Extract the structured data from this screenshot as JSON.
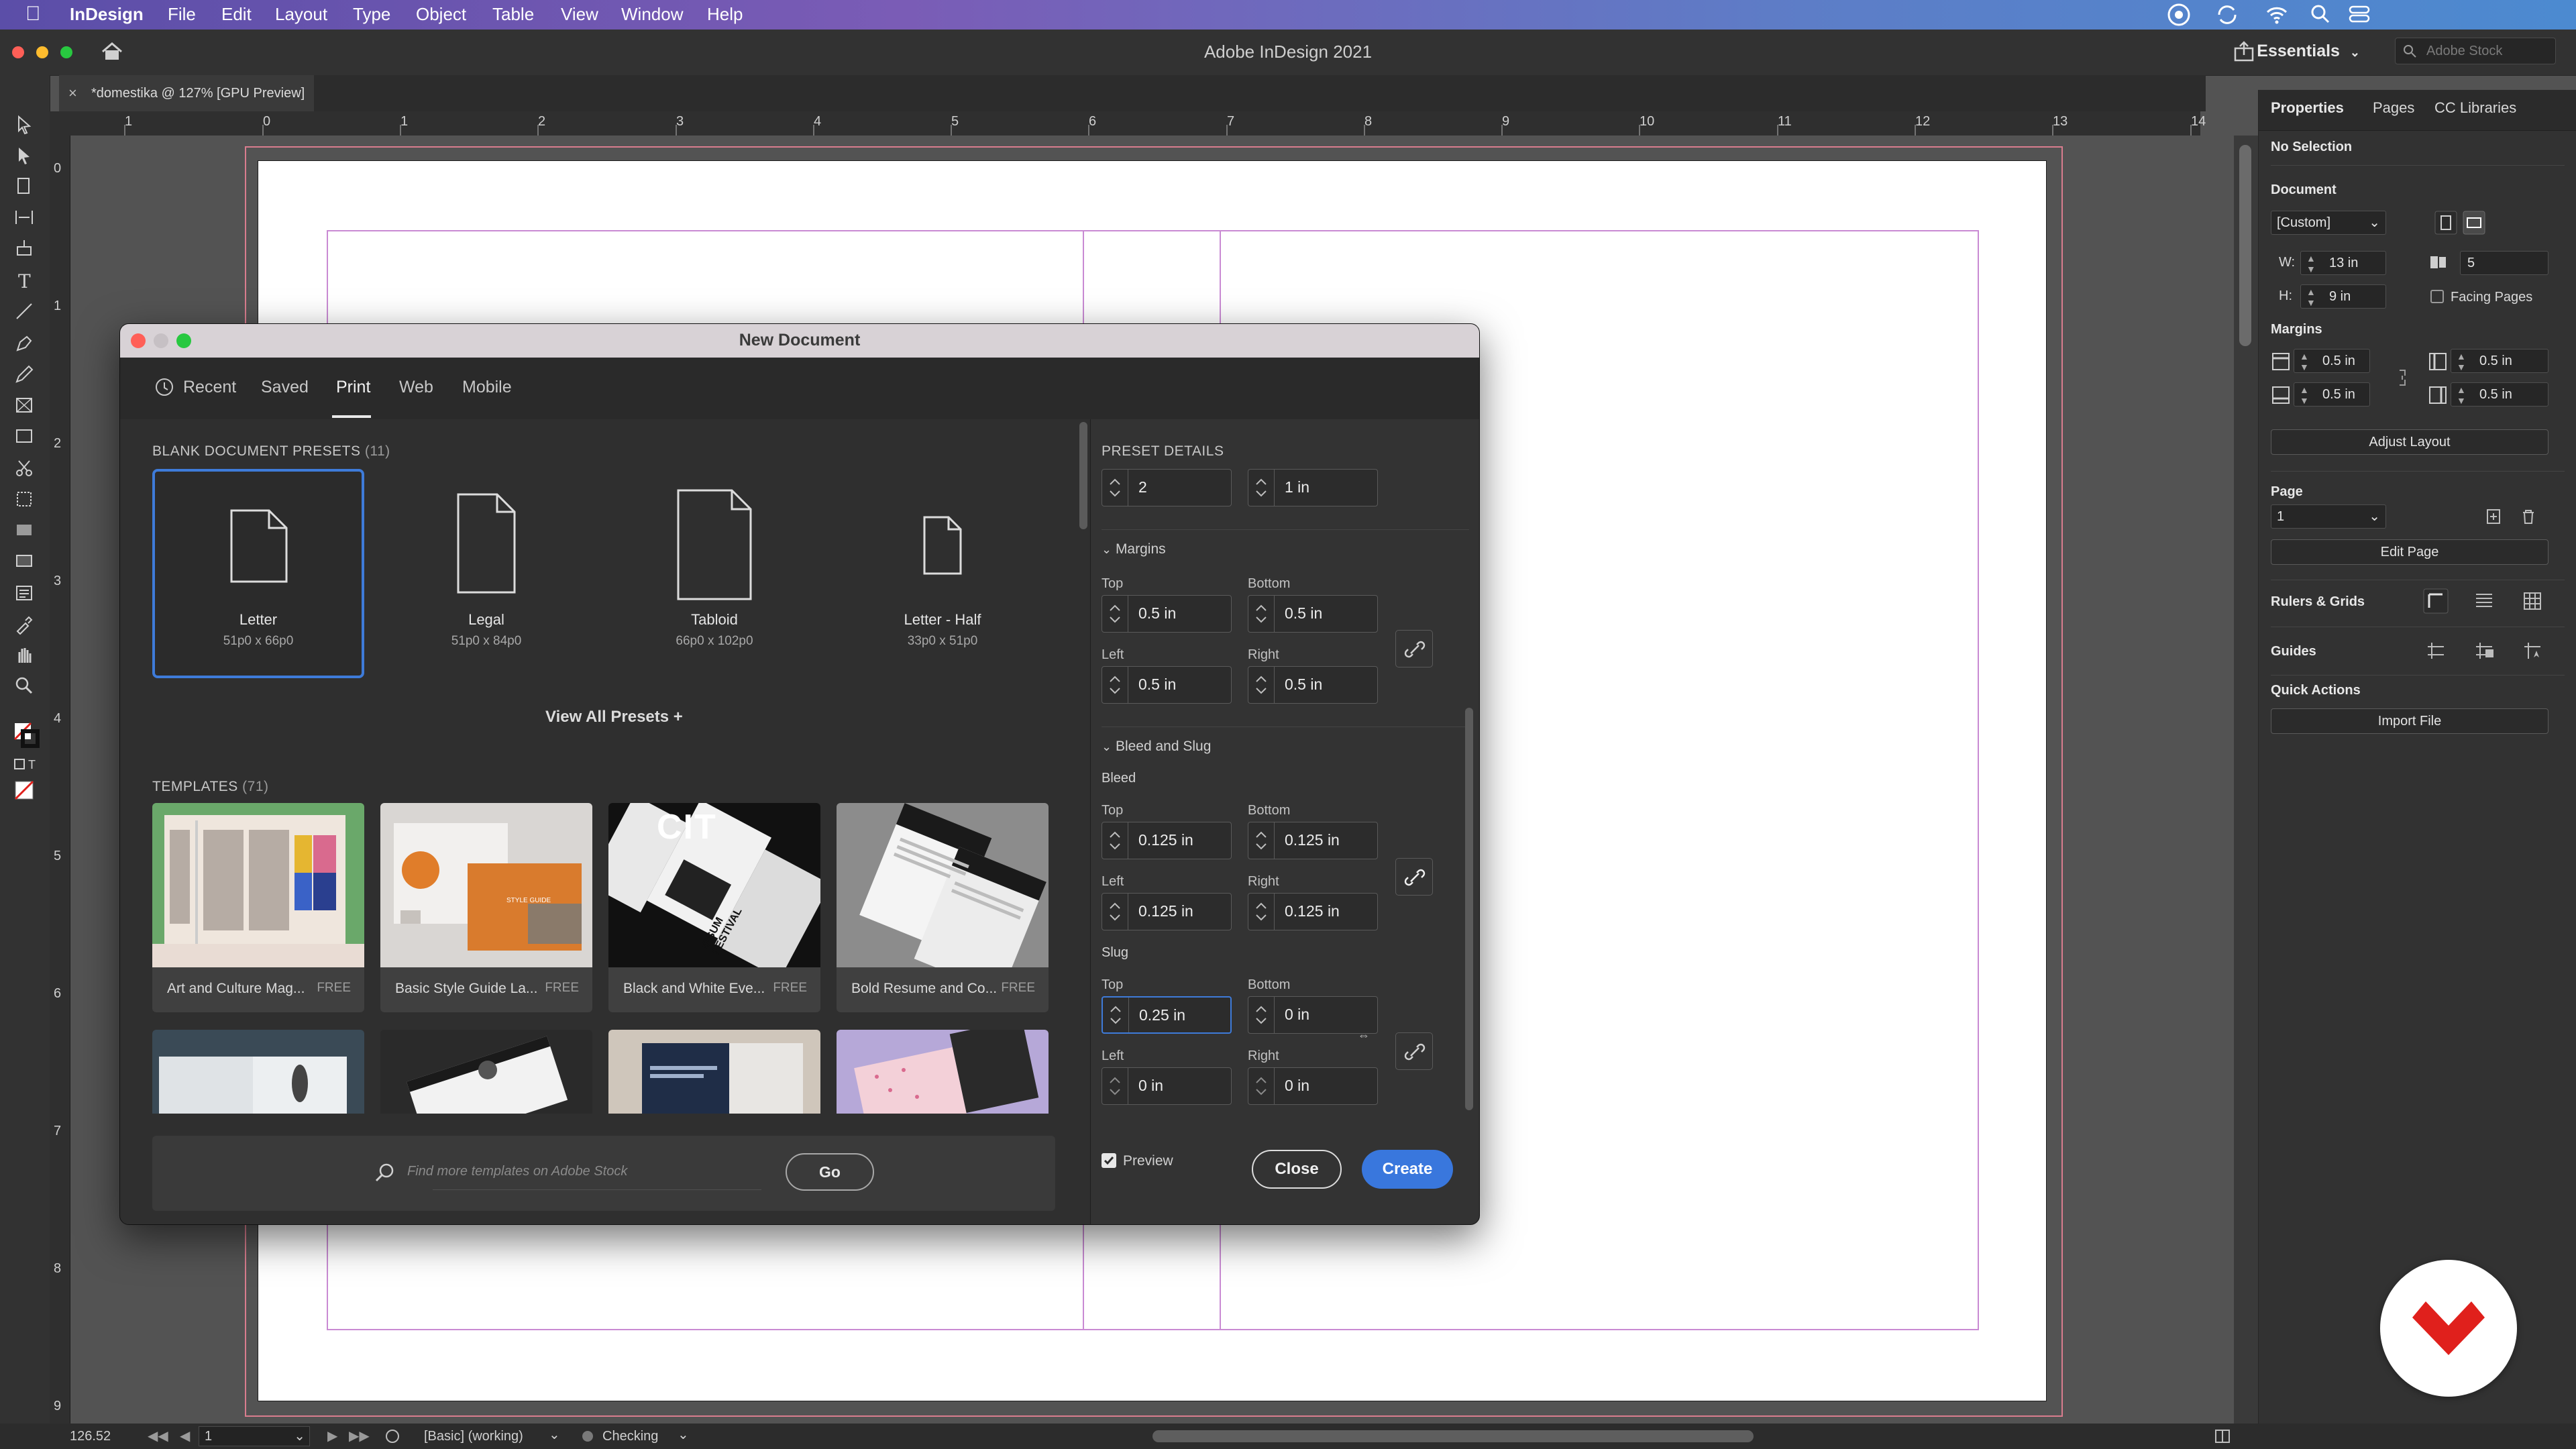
{
  "menubar": {
    "app": "InDesign",
    "items": [
      "File",
      "Edit",
      "Layout",
      "Type",
      "Object",
      "Table",
      "View",
      "Window",
      "Help"
    ]
  },
  "titlebar": {
    "title": "Adobe InDesign 2021",
    "workspace": "Essentials",
    "stock_placeholder": "Adobe Stock"
  },
  "doc_tab": {
    "label": "*domestika @ 127% [GPU Preview]"
  },
  "ruler": {
    "h": [
      "1",
      "0",
      "1",
      "2",
      "3",
      "4",
      "5",
      "6",
      "7",
      "8",
      "9",
      "10",
      "11",
      "12",
      "13",
      "14"
    ],
    "v": [
      "0",
      "1",
      "2",
      "3",
      "4",
      "5",
      "6",
      "7",
      "8",
      "9"
    ]
  },
  "dialog": {
    "title": "New Document",
    "tabs": [
      "Recent",
      "Saved",
      "Print",
      "Web",
      "Mobile"
    ],
    "active_tab": "Print",
    "presets_heading": "BLANK DOCUMENT PRESETS",
    "presets_count": "(11)",
    "presets": [
      {
        "name": "Letter",
        "size": "51p0 x 66p0"
      },
      {
        "name": "Legal",
        "size": "51p0 x 84p0"
      },
      {
        "name": "Tabloid",
        "size": "66p0 x 102p0"
      },
      {
        "name": "Letter - Half",
        "size": "33p0 x 51p0"
      }
    ],
    "view_all": "View All Presets",
    "templates_heading": "TEMPLATES",
    "templates_count": "(71)",
    "templates": [
      {
        "name": "Art and Culture Mag...",
        "badge": "FREE"
      },
      {
        "name": "Basic Style Guide La...",
        "badge": "FREE"
      },
      {
        "name": "Black and White Eve...",
        "badge": "FREE"
      },
      {
        "name": "Bold Resume and Co...",
        "badge": "FREE"
      }
    ],
    "template_text": {
      "cit": "CIT",
      "ipsum": "IPSUM FESTIVAL",
      "style_guide": "STYLE GUIDE"
    },
    "search_placeholder": "Find more templates on Adobe Stock",
    "go": "Go",
    "details": {
      "heading": "PRESET DETAILS",
      "pages": "2",
      "gutter": "1 in",
      "margins_label": "Margins",
      "margins": {
        "top": "0.5 in",
        "bottom": "0.5 in",
        "left": "0.5 in",
        "right": "0.5 in"
      },
      "bleed_slug_label": "Bleed and Slug",
      "bleed_label": "Bleed",
      "bleed": {
        "top": "0.125 in",
        "bottom": "0.125 in",
        "left": "0.125 in",
        "right": "0.125 in"
      },
      "slug_label": "Slug",
      "slug": {
        "top": "0.25 in",
        "bottom": "0 in",
        "left": "0 in",
        "right": "0 in"
      },
      "labels": {
        "top": "Top",
        "bottom": "Bottom",
        "left": "Left",
        "right": "Right"
      }
    },
    "preview_label": "Preview",
    "preview_checked": true,
    "close": "Close",
    "create": "Create"
  },
  "properties": {
    "tabs": [
      "Properties",
      "Pages",
      "CC Libraries"
    ],
    "selection": "No Selection",
    "document_label": "Document",
    "preset": "[Custom]",
    "w_label": "W:",
    "w": "13 in",
    "h_label": "H:",
    "h": "9 in",
    "pages": "5",
    "facing_pages": "Facing Pages",
    "margins_label": "Margins",
    "margins": {
      "top": "0.5 in",
      "bottom": "0.5 in",
      "left": "0.5 in",
      "right": "0.5 in"
    },
    "adjust_layout": "Adjust Layout",
    "page_label": "Page",
    "page_value": "1",
    "edit_page": "Edit Page",
    "rulers_grids": "Rulers & Grids",
    "guides": "Guides",
    "quick_actions": "Quick Actions",
    "import_file": "Import File"
  },
  "status": {
    "zoom": "126.52",
    "page": "1",
    "style": "[Basic] (working)",
    "preflight": "Checking"
  },
  "colors": {
    "accent": "#3977dd",
    "margin_guide": "#c98ad3",
    "bleed_guide": "#d97d8e",
    "badge_red": "#e0201c"
  }
}
